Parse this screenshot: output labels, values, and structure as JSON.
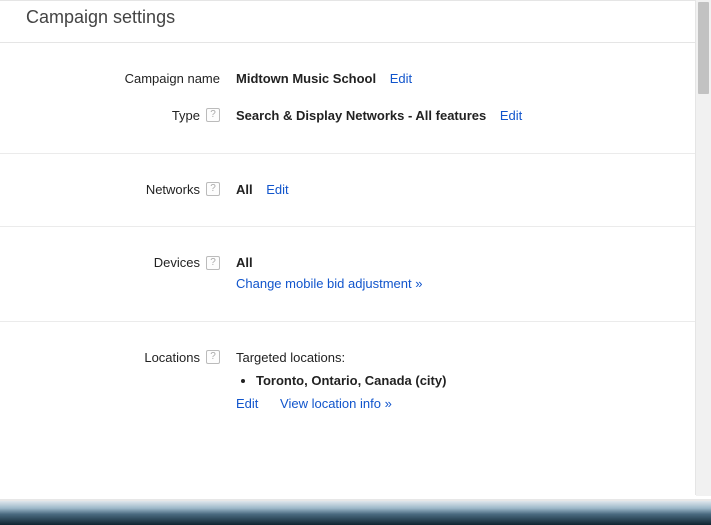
{
  "heading": "Campaign settings",
  "links": {
    "edit": "Edit"
  },
  "help_glyph": "?",
  "campaign_name": {
    "label": "Campaign name",
    "value": "Midtown Music School"
  },
  "type": {
    "label": "Type",
    "value": "Search & Display Networks - All features"
  },
  "networks": {
    "label": "Networks",
    "value": "All"
  },
  "devices": {
    "label": "Devices",
    "value": "All",
    "change_link": "Change mobile bid adjustment »"
  },
  "locations": {
    "label": "Locations",
    "intro": "Targeted locations:",
    "items": [
      "Toronto, Ontario, Canada (city)"
    ],
    "view_link": "View location info »"
  }
}
